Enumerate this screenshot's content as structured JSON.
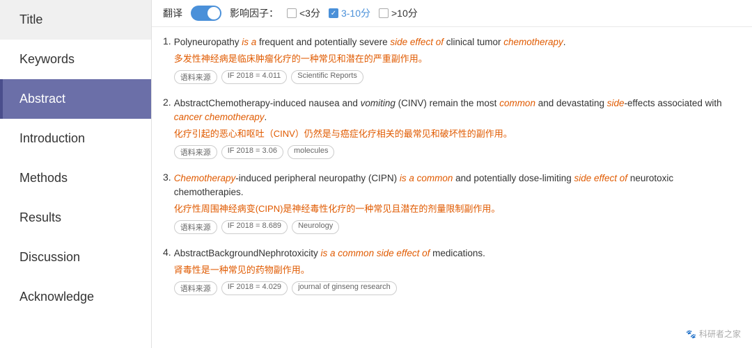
{
  "sidebar": {
    "items": [
      {
        "label": "Title",
        "id": "title",
        "active": false
      },
      {
        "label": "Keywords",
        "id": "keywords",
        "active": false
      },
      {
        "label": "Abstract",
        "id": "abstract",
        "active": true
      },
      {
        "label": "Introduction",
        "id": "introduction",
        "active": false
      },
      {
        "label": "Methods",
        "id": "methods",
        "active": false
      },
      {
        "label": "Results",
        "id": "results",
        "active": false
      },
      {
        "label": "Discussion",
        "id": "discussion",
        "active": false
      },
      {
        "label": "Acknowledge",
        "id": "acknowledge",
        "active": false
      }
    ]
  },
  "toolbar": {
    "translate_label": "翻译",
    "toggle_on": true,
    "impact_label": "影响因子：",
    "filter1_label": "<3分",
    "filter2_label": "3-10分",
    "filter2_checked": true,
    "filter3_label": ">10分"
  },
  "entries": [
    {
      "number": "1.",
      "en_parts": [
        {
          "text": "Polyneuropathy ",
          "style": "normal"
        },
        {
          "text": "is a",
          "style": "red-italic"
        },
        {
          "text": " frequent and potentially severe ",
          "style": "normal"
        },
        {
          "text": "side effect of",
          "style": "red-italic"
        },
        {
          "text": " clinical tumor ",
          "style": "normal"
        },
        {
          "text": "chemotherapy",
          "style": "red-italic"
        },
        {
          "text": ".",
          "style": "normal"
        }
      ],
      "zh": "多发性神经病是临床肿瘤化疗的一种常见和潜在的严重副作用。",
      "tags": [
        {
          "label": "语料来源",
          "type": "source"
        },
        {
          "label": "IF 2018 = 4.011",
          "type": "if"
        },
        {
          "label": "Scientific Reports",
          "type": "journal"
        }
      ]
    },
    {
      "number": "2.",
      "en_parts": [
        {
          "text": "AbstractChemotherapy-induced nausea and ",
          "style": "normal"
        },
        {
          "text": "vomiting",
          "style": "italic"
        },
        {
          "text": " (CINV) remain the most ",
          "style": "normal"
        },
        {
          "text": "common",
          "style": "red-italic"
        },
        {
          "text": " and devastating ",
          "style": "normal"
        },
        {
          "text": "side",
          "style": "red-italic"
        },
        {
          "text": "-effects associated with ",
          "style": "normal"
        },
        {
          "text": "cancer chemotherapy",
          "style": "red-italic"
        },
        {
          "text": ".",
          "style": "normal"
        }
      ],
      "zh": "化疗引起的恶心和呕吐（CINV）仍然是与癌症化疗相关的最常见和破坏性的副作用。",
      "tags": [
        {
          "label": "语料来源",
          "type": "source"
        },
        {
          "label": "IF 2018 = 3.06",
          "type": "if"
        },
        {
          "label": "molecules",
          "type": "journal"
        }
      ]
    },
    {
      "number": "3.",
      "en_parts": [
        {
          "text": "Chemotherapy",
          "style": "red-italic"
        },
        {
          "text": "-induced peripheral neuropathy (CIPN) ",
          "style": "normal"
        },
        {
          "text": "is a common",
          "style": "red-italic"
        },
        {
          "text": " and potentially dose-limiting ",
          "style": "normal"
        },
        {
          "text": "side effect of",
          "style": "red-italic"
        },
        {
          "text": " neurotoxic chemotherapies.",
          "style": "normal"
        }
      ],
      "zh": "化疗性周围神经病变(CIPN)是神经毒性化疗的一种常见且潜在的剂量限制副作用。",
      "tags": [
        {
          "label": "语料来源",
          "type": "source"
        },
        {
          "label": "IF 2018 = 8.689",
          "type": "if"
        },
        {
          "label": "Neurology",
          "type": "journal"
        }
      ]
    },
    {
      "number": "4.",
      "en_parts": [
        {
          "text": "AbstractBackgroundNephrotoxicity ",
          "style": "normal"
        },
        {
          "text": "is a common side effect of",
          "style": "red-italic"
        },
        {
          "text": " medications.",
          "style": "normal"
        }
      ],
      "zh": "肾毒性是一种常见的药物副作用。",
      "tags": [
        {
          "label": "语料来源",
          "type": "source"
        },
        {
          "label": "IF 2018 = 4.029",
          "type": "if"
        },
        {
          "label": "journal of ginseng research",
          "type": "journal"
        }
      ]
    }
  ],
  "watermark": {
    "icon": "🐾",
    "text": "科研者之家"
  }
}
